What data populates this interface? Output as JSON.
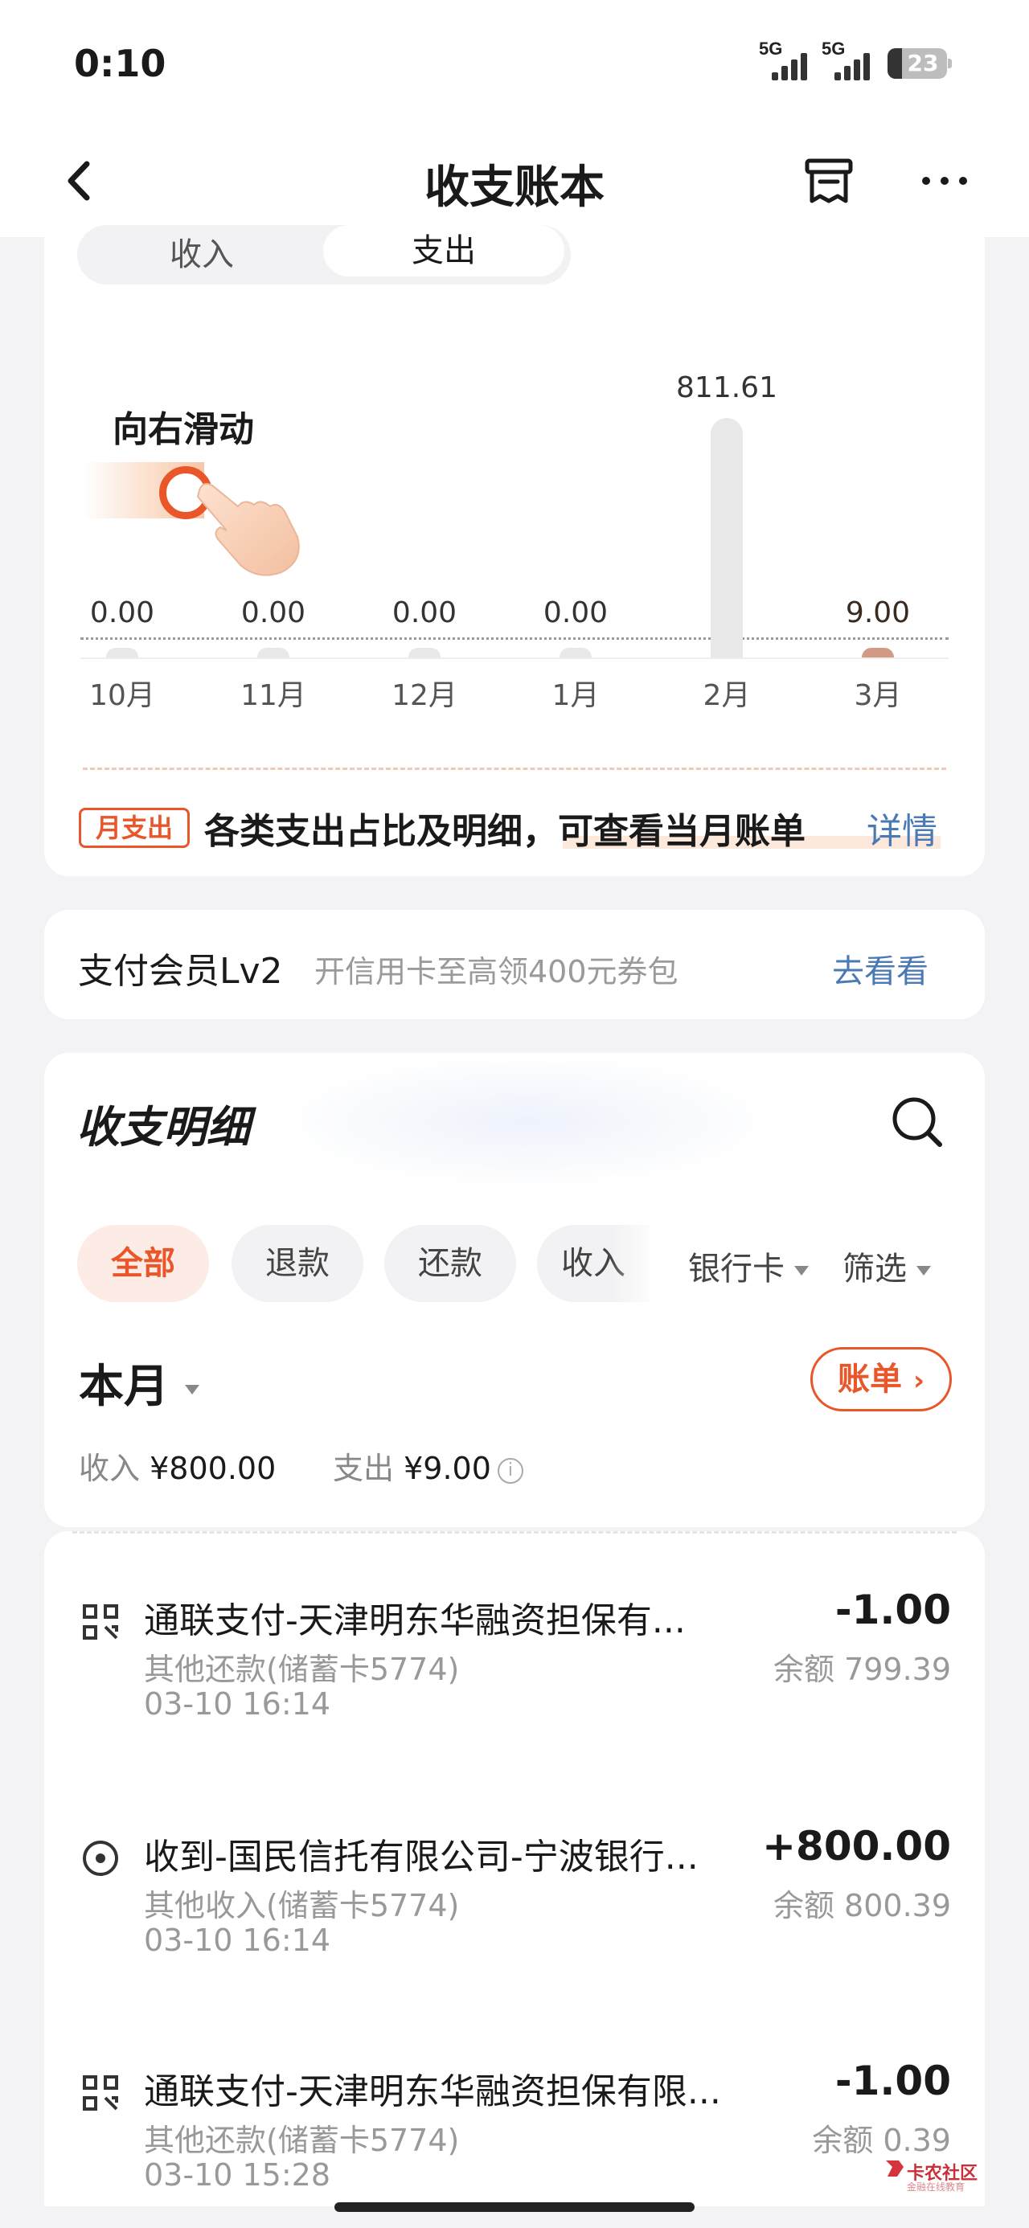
{
  "status_bar": {
    "time": "0:10",
    "signal_1": "5G",
    "signal_2": "5G",
    "battery": "23"
  },
  "nav": {
    "title": "收支账本"
  },
  "toggle": {
    "income": "收入",
    "expense": "支出",
    "selected": "支出"
  },
  "hint": {
    "text": "向右滑动"
  },
  "chart_data": {
    "type": "bar",
    "categories": [
      "10月",
      "11月",
      "12月",
      "1月",
      "2月",
      "3月"
    ],
    "values": [
      0.0,
      0.0,
      0.0,
      0.0,
      811.61,
      9.0
    ],
    "value_labels": [
      "0.00",
      "0.00",
      "0.00",
      "0.00",
      "811.61",
      "9.00"
    ],
    "highlight_index": 5,
    "colors": {
      "bar": "#e8e8e8",
      "active": "#d29a84"
    }
  },
  "banner": {
    "tag": "月支出",
    "text": "各类支出占比及明细，可查看当月账单",
    "link": "详情"
  },
  "member": {
    "title": "支付会员Lv2",
    "subtitle": "开信用卡至高领400元券包",
    "link": "去看看"
  },
  "detail": {
    "title": "收支明细",
    "chips": [
      "全部",
      "退款",
      "还款",
      "收入"
    ],
    "active_chip": "全部",
    "dropdown_bank": "银行卡",
    "dropdown_filter": "筛选",
    "period": "本月",
    "bill_button": "账单",
    "income_label": "收入",
    "income_value": "¥800.00",
    "expense_label": "支出",
    "expense_value": "¥9.00"
  },
  "transactions": [
    {
      "icon": "qr-pay-icon",
      "name": "通联支付-天津明东华融资担保有...",
      "amount": "-1.00",
      "category": "其他还款(储蓄卡5774)",
      "balance": "余额 799.39",
      "time": "03-10 16:14"
    },
    {
      "icon": "income-icon",
      "name": "收到-国民信托有限公司-宁波银行...",
      "amount": "+800.00",
      "category": "其他收入(储蓄卡5774)",
      "balance": "余额 800.39",
      "time": "03-10 16:14"
    },
    {
      "icon": "qr-pay-icon",
      "name": "通联支付-天津明东华融资担保有限...",
      "amount": "-1.00",
      "category": "其他还款(储蓄卡5774)",
      "balance": "余额 0.39",
      "time": "03-10 15:28"
    }
  ],
  "watermark": {
    "text": "卡农社区",
    "sub": "金融在线教育"
  },
  "colors": {
    "accent": "#e8562a",
    "link": "#4a7ab5",
    "background": "#f3f3f5"
  }
}
